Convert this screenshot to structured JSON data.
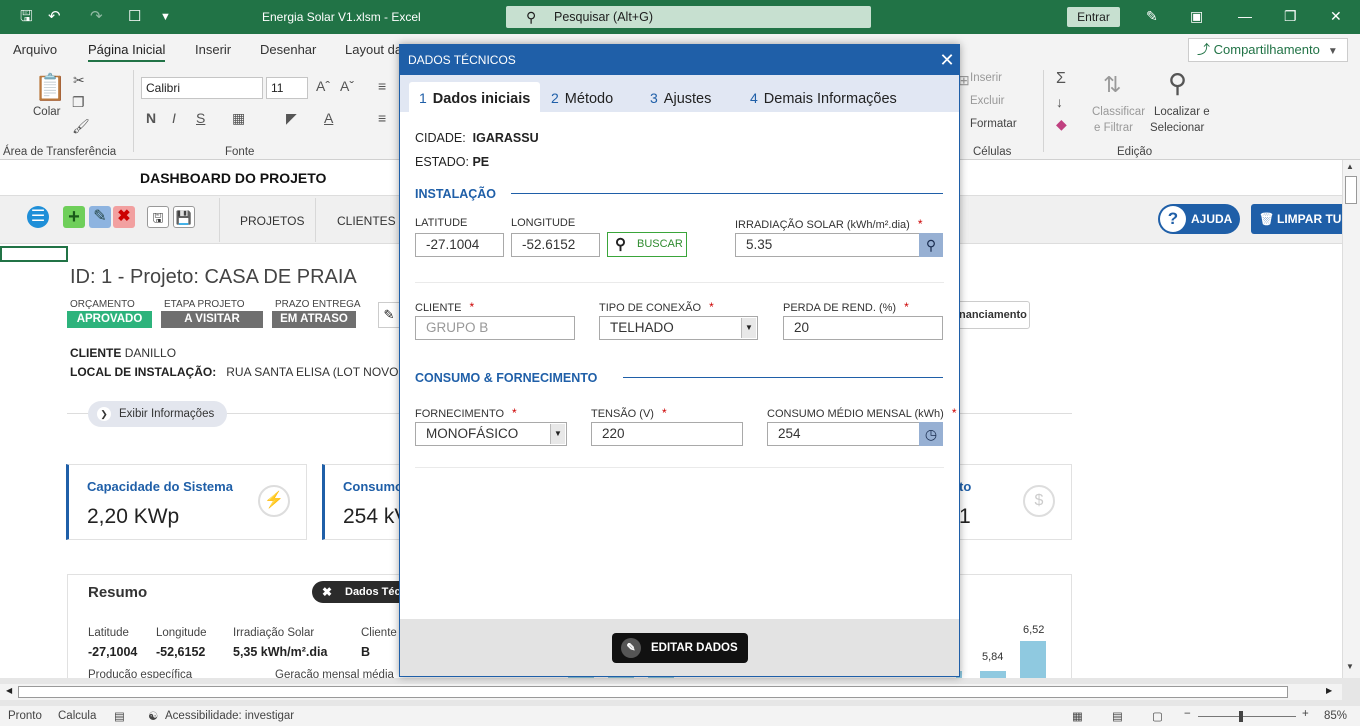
{
  "titlebar": {
    "file_title": "Energia Solar V1.xlsm  -  Excel",
    "search_placeholder": "Pesquisar (Alt+G)",
    "signin_label": "Entrar"
  },
  "ribbon": {
    "tabs": [
      "Arquivo",
      "Página Inicial",
      "Inserir",
      "Desenhar",
      "Layout da"
    ],
    "share_label": "Compartilhamento",
    "paste_label": "Colar",
    "font_name": "Calibri",
    "font_size": "11",
    "group_clipboard": "Área de Transferência",
    "group_font": "Fonte",
    "group_cells": "Células",
    "group_edit": "Edição",
    "cell_insert": "Inserir",
    "cell_delete": "Excluir",
    "cell_format": "Formatar",
    "sort_label_1": "Classificar",
    "sort_label_2": "e Filtrar",
    "find_label_1": "Localizar e",
    "find_label_2": "Selecionar"
  },
  "dashboard": {
    "title": "DASHBOARD DO PROJETO",
    "nav": [
      "PROJETOS",
      "CLIENTES"
    ],
    "help_label": "AJUDA",
    "clear_label": "LIMPAR TUD",
    "project_title": "ID: 1 - Projeto: CASA DE PRAIA",
    "status_labels": [
      "ORÇAMENTO",
      "ETAPA PROJETO",
      "PRAZO ENTREGA"
    ],
    "status_values": [
      "APROVADO",
      "A VISITAR",
      "EM ATRASO"
    ],
    "status_colors": [
      "#2db37c",
      "#6f6f6f",
      "#6f6f6f"
    ],
    "financing_label": "nanciamento",
    "client_label": "CLIENTE",
    "client_value": "DANILLO",
    "location_label": "LOCAL DE INSTALAÇÃO:",
    "location_value": "RUA SANTA ELISA (LOT NOVO IG",
    "show_info_label": "Exibir Informações",
    "cards": [
      {
        "title": "Capacidade do Sistema",
        "value": "2,20 KWp",
        "icon": "bolt-icon"
      },
      {
        "title": "Consumo",
        "value": "254 kV",
        "icon": ""
      },
      {
        "title": "to",
        "value": "1",
        "icon": "dollar-icon"
      }
    ],
    "summary": {
      "title": "Resumo",
      "tech_data_label": "Dados Téc",
      "labels": [
        "Latitude",
        "Longitude",
        "Irradiação Solar",
        "Cliente"
      ],
      "values": [
        "-27,1004",
        "-52,6152",
        "5,35 kWh/m².dia",
        "B"
      ],
      "sub_labels": [
        "Produção específica",
        "Geração mensal média"
      ],
      "bar_labels": [
        "5,84",
        "6,52"
      ]
    }
  },
  "status_bar": {
    "ready": "Pronto",
    "calc": "Calcula",
    "accessibility": "Acessibilidade: investigar",
    "zoom": "85%"
  },
  "modal": {
    "title": "DADOS TÉCNICOS",
    "tabs": [
      {
        "num": "1",
        "label": "Dados iniciais"
      },
      {
        "num": "2",
        "label": "Método"
      },
      {
        "num": "3",
        "label": "Ajustes"
      },
      {
        "num": "4",
        "label": "Demais Informações"
      }
    ],
    "city_label": "CIDADE:",
    "city_value": "IGARASSU",
    "state_label": "ESTADO:",
    "state_value": "PE",
    "section_install": "INSTALAÇÃO",
    "latitude_label": "LATITUDE",
    "latitude_value": "-27.1004",
    "longitude_label": "LONGITUDE",
    "longitude_value": "-52.6152",
    "search_label": "BUSCAR",
    "irradiation_label": "IRRADIAÇÃO SOLAR (kWh/m².dia)",
    "irradiation_value": "5.35",
    "client_label": "CLIENTE",
    "client_value": "GRUPO B",
    "connection_label": "TIPO DE CONEXÃO",
    "connection_value": "TELHADO",
    "loss_label": "PERDA DE REND. (%)",
    "loss_value": "20",
    "section_supply": "CONSUMO & FORNECIMENTO",
    "supply_label": "FORNECIMENTO",
    "supply_value": "MONOFÁSICO",
    "voltage_label": "TENSÃO (V)",
    "voltage_value": "220",
    "consumption_label": "CONSUMO MÉDIO MENSAL (kWh)",
    "consumption_value": "254",
    "required_mark": "*",
    "edit_label": "EDITAR DADOS"
  }
}
